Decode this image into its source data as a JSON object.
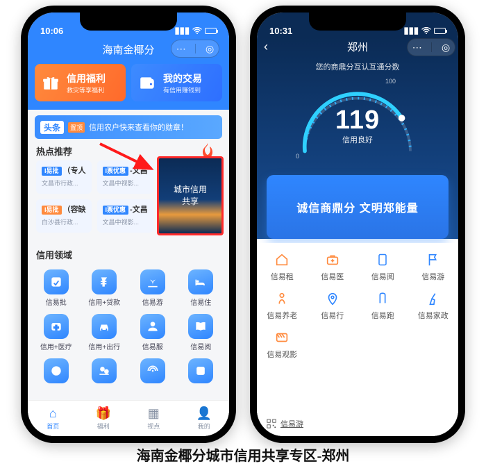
{
  "caption": "海南金椰分城市信用共享专区-郑州",
  "left": {
    "status_time": "10:06",
    "title": "海南金椰分",
    "cards": {
      "welfare": {
        "title": "信用福利",
        "sub": "救灾等享福利"
      },
      "trade": {
        "title": "我的交易",
        "sub": "有信用赚钱到"
      }
    },
    "banner": {
      "tag": "头条",
      "hot": "置顶",
      "text": "信用农户快来查看你的勋章！"
    },
    "hot_section": "热点推荐",
    "hot": [
      {
        "pill": "I易批",
        "suffix": "（专人",
        "sub": "文昌市行政..."
      },
      {
        "pill": "I票优惠",
        "suffix": "-文昌",
        "sub": "文昌中视影..."
      },
      {
        "pill": "I易批",
        "suffix": "（容缺",
        "sub": "白沙县行政..."
      },
      {
        "pill": "I票优惠",
        "suffix": "-文昌",
        "sub": "文昌中视影..."
      }
    ],
    "city_share": "城市信用\n共享",
    "domain_section": "信用领域",
    "domain_row1": [
      "信易批",
      "信用+贷款",
      "信易游",
      "信易住"
    ],
    "domain_row2": [
      "信用+医疗",
      "信用+出行",
      "信易服",
      "信易阅"
    ],
    "tabs": [
      "首页",
      "福利",
      "视点",
      "我的"
    ]
  },
  "right": {
    "status_time": "10:31",
    "title": "郑州",
    "subtitle": "您的商鼎分互认互通分数",
    "gauge": {
      "min": "0",
      "max": "100",
      "score": "119",
      "status": "信用良好"
    },
    "slogan": "诚信商鼎分  文明郑能量",
    "grid1": [
      "信易租",
      "信易医",
      "信易阅",
      "信易游"
    ],
    "grid2": [
      "信易养老",
      "信易行",
      "信易跑",
      "信易家政"
    ],
    "grid3": [
      "信易观影"
    ],
    "footer": "信易游"
  }
}
